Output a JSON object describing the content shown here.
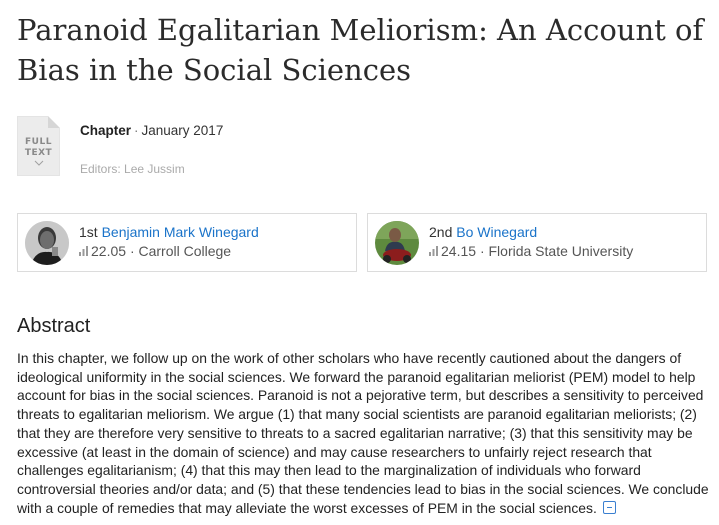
{
  "publication": {
    "title": "Paranoid Egalitarian Meliorism: An Account of Bias in the Social Sciences",
    "full_text_label_1": "FULL",
    "full_text_label_2": "TEXT",
    "full_text_icon": "chevron-down-icon",
    "type": "Chapter",
    "separator": "·",
    "date": "January 2017",
    "editors": "Editors: Lee Jussim"
  },
  "authors": [
    {
      "position": "1st",
      "name": "Benjamin Mark Winegard",
      "score": "22.05",
      "affiliation": "Carroll College",
      "icon": "score-bars-icon"
    },
    {
      "position": "2nd",
      "name": "Bo Winegard",
      "score": "24.15",
      "affiliation": "Florida State University",
      "icon": "score-bars-icon"
    }
  ],
  "abstract": {
    "heading": "Abstract",
    "text": "In this chapter, we follow up on the work of other scholars who have recently cautioned about the dangers of ideological uniformity in the social sciences. We forward the paranoid egalitarian meliorist (PEM) model to help account for bias in the social sciences. Paranoid is not a pejorative term, but describes a sensitivity to perceived threats to egalitarian meliorism. We argue (1) that many social scientists are paranoid egalitarian meliorists; (2) that they are therefore very sensitive to threats to a sacred egalitarian narrative; (3) that this sensitivity may be excessive (at least in the domain of science) and may cause researchers to unfairly reject research that challenges egalitarianism; (4) that this may then lead to the marginalization of individuals who forward controversial theories and/or data; and (5) that these tendencies lead to bias in the social sciences. We conclude with a couple of remedies that may alleviate the worst excesses of PEM in the social sciences.",
    "collapse_icon": "collapse-icon"
  },
  "colors": {
    "link": "#1a73c9",
    "collapse": "#3a7fd0"
  }
}
